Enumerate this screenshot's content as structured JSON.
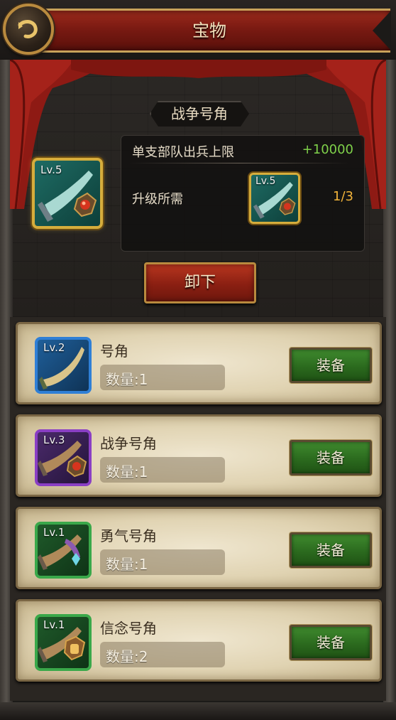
{
  "header": {
    "title": "宝物",
    "back_icon": "back-arrow-icon"
  },
  "selected_item": {
    "name": "战争号角",
    "level": "Lv.5",
    "icon": "war-horn-icon",
    "stat_label": "单支部队出兵上限",
    "stat_value": "+10000",
    "upgrade_label": "升级所需",
    "upgrade_item_level": "Lv.5",
    "upgrade_count": "1/3",
    "unequip_label": "卸下"
  },
  "items": [
    {
      "level": "Lv.2",
      "name": "号角",
      "quantity": "数量:1",
      "equip_label": "装备",
      "rarity_color": "#2f7fd6",
      "icon": "horn-icon"
    },
    {
      "level": "Lv.3",
      "name": "战争号角",
      "quantity": "数量:1",
      "equip_label": "装备",
      "rarity_color": "#8a3fc4",
      "icon": "war-horn-icon"
    },
    {
      "level": "Lv.1",
      "name": "勇气号角",
      "quantity": "数量:1",
      "equip_label": "装备",
      "rarity_color": "#3aa84a",
      "icon": "courage-horn-icon"
    },
    {
      "level": "Lv.1",
      "name": "信念号角",
      "quantity": "数量:2",
      "equip_label": "装备",
      "rarity_color": "#3aa84a",
      "icon": "faith-horn-icon"
    }
  ],
  "colors": {
    "accent_gold": "#d6ad3c",
    "stat_green": "#7fd14a",
    "count_orange": "#f3b43a",
    "banner_red": "#8a1f12",
    "equip_green": "#2b6a1e"
  }
}
